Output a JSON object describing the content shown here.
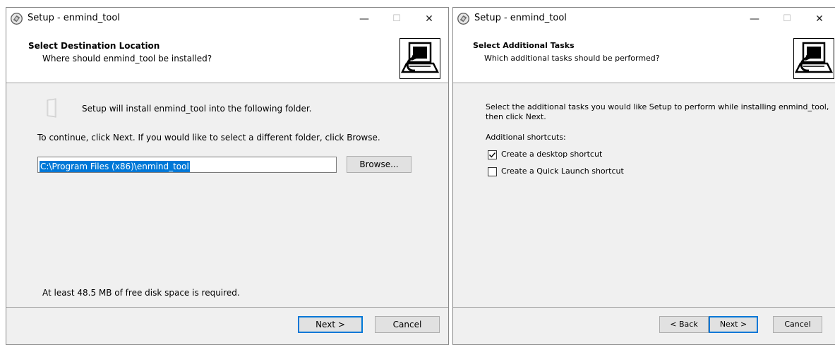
{
  "left": {
    "title": "Setup - enmind_tool",
    "minimize_glyph": "—",
    "maximize_glyph": "☐",
    "close_glyph": "✕",
    "header_title": "Select Destination Location",
    "header_sub": "Where should enmind_tool be installed?",
    "install_msg": "Setup will install enmind_tool into the following folder.",
    "continue_msg": "To continue, click Next. If you would like to select a different folder, click Browse.",
    "path_value": "C:\\Program Files (x86)\\enmind_tool",
    "browse_label": "Browse...",
    "disk_msg": "At least 48.5 MB of free disk space is required.",
    "next_label": "Next >",
    "cancel_label": "Cancel"
  },
  "right": {
    "title": "Setup - enmind_tool",
    "minimize_glyph": "—",
    "maximize_glyph": "☐",
    "close_glyph": "✕",
    "header_title": "Select Additional Tasks",
    "header_sub": "Which additional tasks should be performed?",
    "tasks_msg_line1": "Select the additional tasks you would like Setup to perform while installing enmind_tool,",
    "tasks_msg_line2": "then click Next.",
    "shortcuts_label": "Additional shortcuts:",
    "checkboxes": [
      {
        "label": "Create a desktop shortcut",
        "checked": true
      },
      {
        "label": "Create a Quick Launch shortcut",
        "checked": false
      }
    ],
    "back_label": "< Back",
    "next_label": "Next >",
    "cancel_label": "Cancel"
  },
  "icons": {
    "app": "setup-app-icon",
    "wizard": "computer-install-icon",
    "folder": "folder-icon",
    "checkmark": "checkmark-icon"
  }
}
